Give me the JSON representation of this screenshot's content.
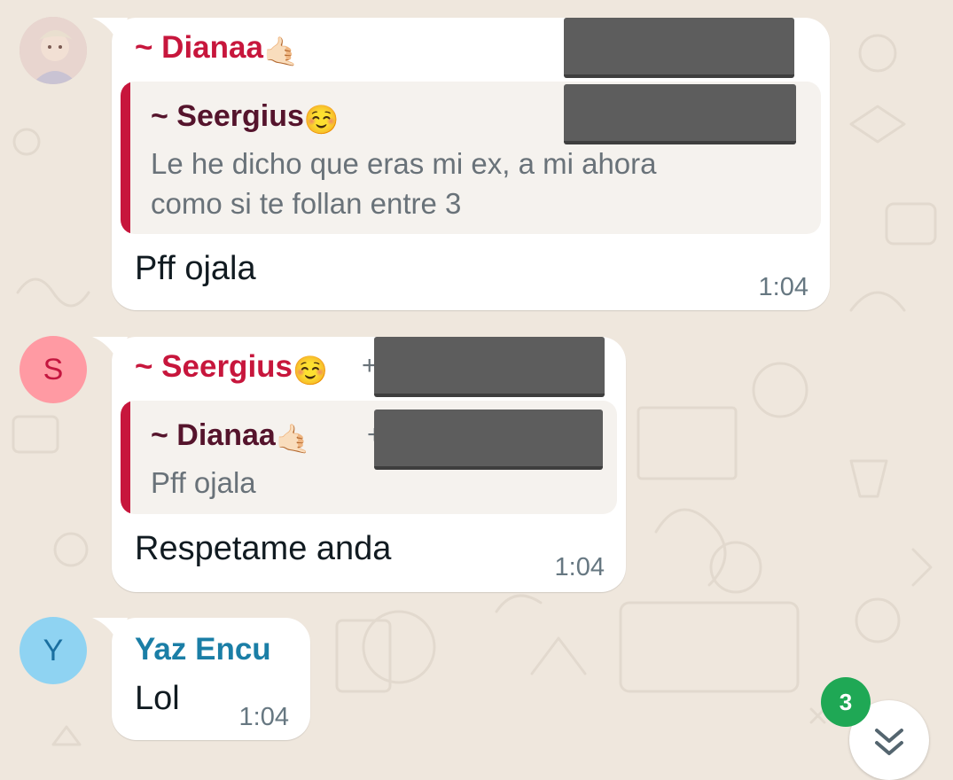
{
  "colors": {
    "background": "#efe7dd",
    "dianaa_name": "#c7163c",
    "seergius_name": "#c7163c",
    "yaz_name": "#1a7ea6",
    "quote_bar": "#c7163c",
    "badge_green": "#1fa855"
  },
  "messages": [
    {
      "sender": "~ Dianaa",
      "sender_emoji": "🤙🏻",
      "quote": {
        "name": "~ Seergius",
        "name_emoji": "☺️",
        "text": "Le he dicho que eras mi ex, a mi ahora\ncomo si te follan entre 3"
      },
      "text": "Pff ojala",
      "time": "1:04"
    },
    {
      "avatar_letter": "S",
      "sender": "~ Seergius",
      "sender_emoji": "☺️",
      "sender_extra": "+",
      "quote": {
        "name": "~ Dianaa",
        "name_emoji": "🤙🏻",
        "name_extra": "+",
        "text": "Pff ojala"
      },
      "text": "Respetame anda",
      "time": "1:04"
    },
    {
      "avatar_letter": "Y",
      "sender": "Yaz Encu",
      "text": "Lol",
      "time": "1:04"
    }
  ],
  "unread_count": "3",
  "scroll_icon": "double-chevron-down-icon"
}
